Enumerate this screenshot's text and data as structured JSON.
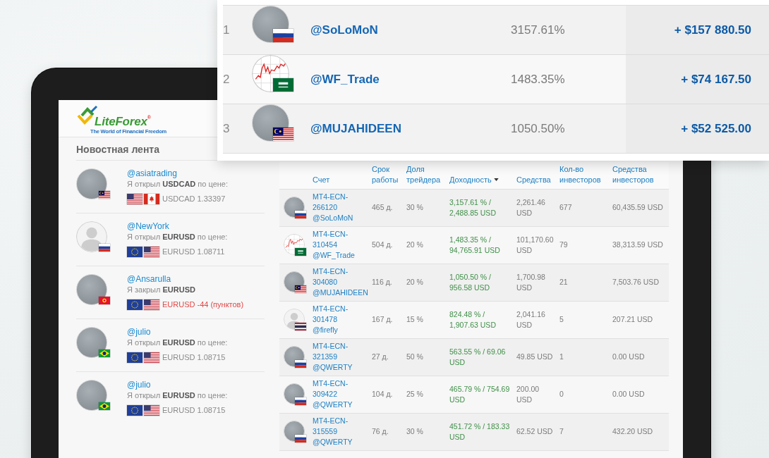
{
  "leaderboard": {
    "rows": [
      {
        "rank": "1",
        "avatar": {
          "kind": "photo"
        },
        "flag": {
          "kind": "ru"
        },
        "user": "@SoLoMoN",
        "return": "3157.61%",
        "profit": "+ $157 880.50"
      },
      {
        "rank": "2",
        "avatar": {
          "kind": "chart"
        },
        "flag": {
          "kind": "sa"
        },
        "user": "@WF_Trade",
        "return": "1483.35%",
        "profit": "+ $74 167.50"
      },
      {
        "rank": "3",
        "avatar": {
          "kind": "photo"
        },
        "flag": {
          "kind": "my"
        },
        "user": "@MUJAHIDEEN",
        "return": "1050.50%",
        "profit": "+ $52 525.00"
      }
    ]
  },
  "device_screen": {
    "logo": {
      "name": "LiteForex$^{®}$",
      "tagline": "The World of Financial Freedom"
    },
    "news_feed": {
      "title": "Новостная лента",
      "items": [
        {
          "avatar": {
            "kind": "photo"
          },
          "flag": {
            "kind": "my"
          },
          "user": "@asiatrading",
          "action": "Я открыл **USDCAD** по цене:",
          "pair_flags": [
            {
              "kind": "us"
            },
            {
              "kind": "ca"
            }
          ],
          "result": "USDCAD 1.33397",
          "negative": false
        },
        {
          "avatar": {
            "kind": "silhouette"
          },
          "flag": {
            "kind": "ru"
          },
          "user": "@NewYork",
          "action": "Я открыл **EURUSD** по цене:",
          "pair_flags": [
            {
              "kind": "eu"
            },
            {
              "kind": "us"
            }
          ],
          "result": "EURUSD 1.08711",
          "negative": false
        },
        {
          "avatar": {
            "kind": "photo"
          },
          "flag": {
            "kind": "kg"
          },
          "user": "@Ansarulla",
          "action": "Я закрыл **EURUSD**",
          "pair_flags": [
            {
              "kind": "eu"
            },
            {
              "kind": "us"
            }
          ],
          "result": "EURUSD -44 (пунктов)",
          "negative": true
        },
        {
          "avatar": {
            "kind": "photo"
          },
          "flag": {
            "kind": "br"
          },
          "user": "@julio",
          "action": "Я открыл **EURUSD** по цене:",
          "pair_flags": [
            {
              "kind": "eu"
            },
            {
              "kind": "us"
            }
          ],
          "result": "EURUSD 1.08715",
          "negative": false
        },
        {
          "avatar": {
            "kind": "photo"
          },
          "flag": {
            "kind": "br"
          },
          "user": "@julio",
          "action": "Я открыл **EURUSD** по цене:",
          "pair_flags": [
            {
              "kind": "eu"
            },
            {
              "kind": "us"
            }
          ],
          "result": "EURUSD 1.08715",
          "negative": false
        }
      ]
    },
    "ratings_table": {
      "columns": [
        {
          "label": "Счет",
          "sorted": false
        },
        {
          "label": "Срок работы",
          "sorted": false
        },
        {
          "label": "Доля трейдера",
          "sorted": false
        },
        {
          "label": "Доходность",
          "sorted": true
        },
        {
          "label": "Средства",
          "sorted": false
        },
        {
          "label": "Кол-во инвесторов",
          "sorted": false
        },
        {
          "label": "Средства инвесторов",
          "sorted": false
        }
      ],
      "rows": [
        {
          "avatar": {
            "kind": "photo"
          },
          "flag": {
            "kind": "ru"
          },
          "account": "MT4-ECN-266120",
          "user": "@SoLoMoN",
          "term": "465 д.",
          "share": "30 %",
          "return": "3,157.61 % / 2,488.85 USD",
          "equity": "2,261.46 USD",
          "investors": "677",
          "investor_funds": "60,435.59 USD"
        },
        {
          "avatar": {
            "kind": "chart"
          },
          "flag": {
            "kind": "sa"
          },
          "account": "MT4-ECN-310454",
          "user": "@WF_Trade",
          "term": "504 д.",
          "share": "20 %",
          "return": "1,483.35 % / 94,765.91 USD",
          "equity": "101,170.60 USD",
          "investors": "79",
          "investor_funds": "38,313.59 USD"
        },
        {
          "avatar": {
            "kind": "photo"
          },
          "flag": {
            "kind": "my"
          },
          "account": "MT4-ECN-304080",
          "user": "@MUJAHIDEEN",
          "term": "116 д.",
          "share": "20 %",
          "return": "1,050.50 % / 956.58 USD",
          "equity": "1,700.98 USD",
          "investors": "21",
          "investor_funds": "7,503.76 USD"
        },
        {
          "avatar": {
            "kind": "silhouette"
          },
          "flag": {
            "kind": "th"
          },
          "account": "MT4-ECN-301478",
          "user": "@firefly",
          "term": "167 д.",
          "share": "15 %",
          "return": "824.48 % / 1,907.63 USD",
          "equity": "2,041.16 USD",
          "investors": "5",
          "investor_funds": "207.21 USD"
        },
        {
          "avatar": {
            "kind": "photo"
          },
          "flag": {
            "kind": "ru"
          },
          "account": "MT4-ECN-321359",
          "user": "@QWERTY",
          "term": "27 д.",
          "share": "50 %",
          "return": "563.55 % / 69.06 USD",
          "equity": "49.85 USD",
          "investors": "1",
          "investor_funds": "0.00 USD"
        },
        {
          "avatar": {
            "kind": "photo"
          },
          "flag": {
            "kind": "ru"
          },
          "account": "MT4-ECN-309422",
          "user": "@QWERTY",
          "term": "104 д.",
          "share": "25 %",
          "return": "465.79 % / 754.69 USD",
          "equity": "200.00 USD",
          "investors": "0",
          "investor_funds": "0.00 USD"
        },
        {
          "avatar": {
            "kind": "photo"
          },
          "flag": {
            "kind": "ru"
          },
          "account": "MT4-ECN-315559",
          "user": "@QWERTY",
          "term": "76 д.",
          "share": "30 %",
          "return": "451.72 % / 183.33 USD",
          "equity": "62.52 USD",
          "investors": "7",
          "investor_funds": "432.20 USD"
        }
      ]
    }
  }
}
